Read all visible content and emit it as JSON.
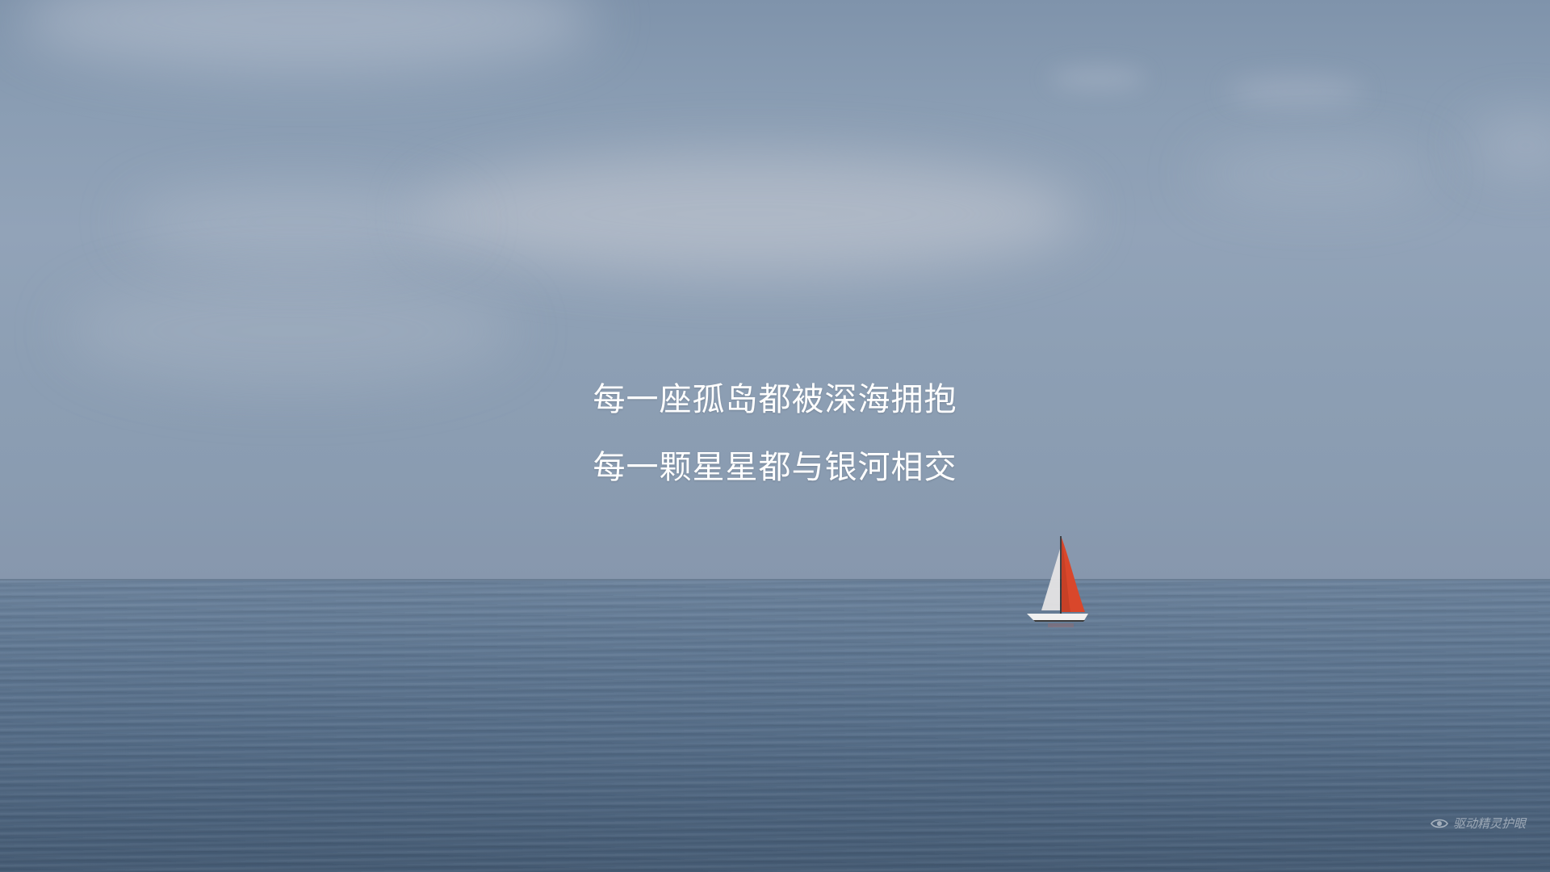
{
  "slide": {
    "line1": "每一座孤岛都被深海拥抱",
    "line2": "每一颗星星都与银河相交"
  },
  "image": {
    "subject": "sailboat-on-calm-sea",
    "sail_color": "#d9472b",
    "sky_color": "#8fa1b6",
    "sea_color": "#566e89"
  },
  "watermark": {
    "icon": "eye-icon",
    "text": "驱动精灵护眼"
  }
}
